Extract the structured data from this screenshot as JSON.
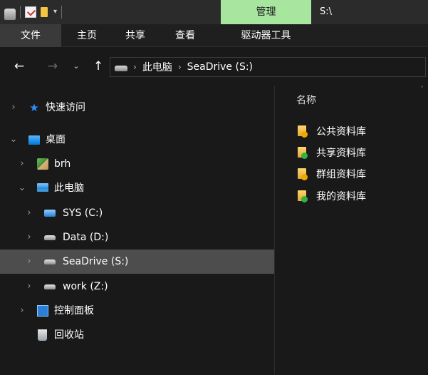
{
  "title_bar": {
    "context_tab": "管理",
    "path_title": "S:\\"
  },
  "ribbon": {
    "tabs": [
      "文件",
      "主页",
      "共享",
      "查看",
      "驱动器工具"
    ]
  },
  "address_bar": {
    "back_glyph": "←",
    "forward_glyph": "→",
    "recent_glyph": "⌄",
    "up_glyph": "↑",
    "breadcrumbs": [
      "此电脑",
      "SeaDrive (S:)"
    ]
  },
  "nav_tree": [
    {
      "label": "快速访问",
      "icon": "star-icon",
      "expanded": false
    },
    {
      "label": "桌面",
      "icon": "desktop-icon",
      "expanded": true
    },
    {
      "label": "brh",
      "icon": "user-folder-icon",
      "expanded": false
    },
    {
      "label": "此电脑",
      "icon": "this-pc-icon",
      "expanded": true
    },
    {
      "label": "SYS (C:)",
      "icon": "system-drive-icon",
      "expanded": false
    },
    {
      "label": "Data (D:)",
      "icon": "drive-icon",
      "expanded": false
    },
    {
      "label": "SeaDrive (S:)",
      "icon": "drive-icon",
      "expanded": false,
      "selected": true
    },
    {
      "label": "work (Z:)",
      "icon": "drive-icon",
      "expanded": false
    },
    {
      "label": "控制面板",
      "icon": "control-panel-icon",
      "expanded": false
    },
    {
      "label": "回收站",
      "icon": "recycle-bin-icon",
      "expanded": false
    }
  ],
  "content": {
    "column_header": "名称",
    "items": [
      {
        "label": "公共资料库",
        "overlay_color": "#f0a800"
      },
      {
        "label": "共享资料库",
        "overlay_color": "#2fb344"
      },
      {
        "label": "群组资料库",
        "overlay_color": "#f0a800"
      },
      {
        "label": "我的资料库",
        "overlay_color": "#2fb344"
      }
    ]
  },
  "colors": {
    "context_tab": "#a8e6a0",
    "selection": "#4d4d4d",
    "background": "#191919"
  }
}
